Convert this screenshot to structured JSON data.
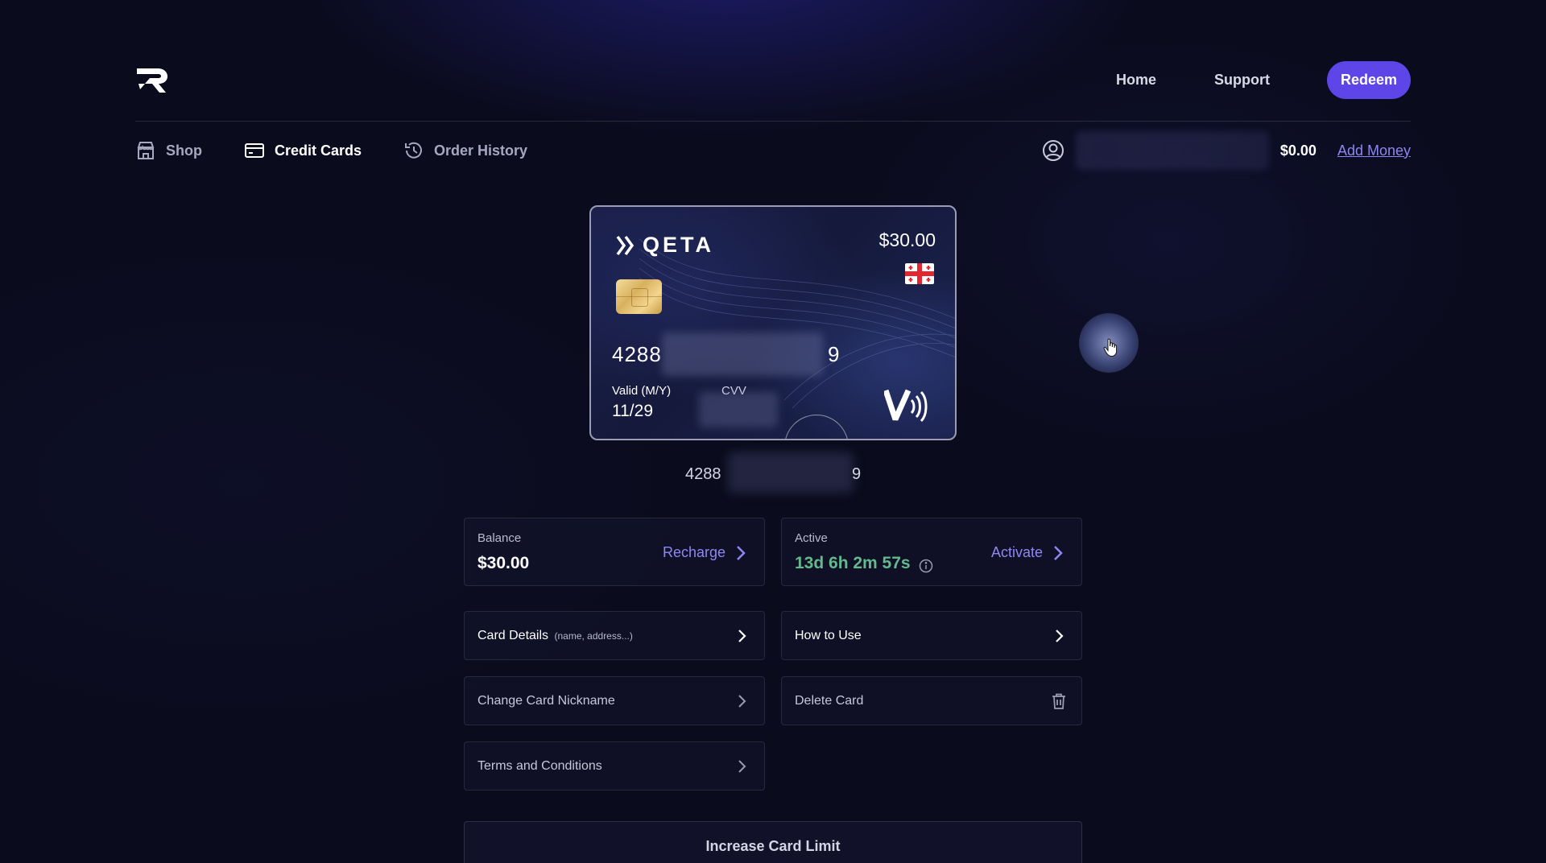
{
  "header": {
    "logo_icon": "r-brand-logo-icon",
    "nav": {
      "home": "Home",
      "support": "Support",
      "redeem": "Redeem"
    },
    "accent_color": "#5d45e8"
  },
  "sub_nav": {
    "items": [
      {
        "label": "Shop",
        "icon": "store-icon"
      },
      {
        "label": "Credit Cards",
        "icon": "credit-card-icon",
        "active": true
      },
      {
        "label": "Order History",
        "icon": "history-icon"
      }
    ]
  },
  "account": {
    "user_icon": "user-circle-icon",
    "balance": "$0.00",
    "add_money": "Add Money"
  },
  "card": {
    "brand": "QETA",
    "amount": "$30.00",
    "number_start": "4288",
    "number_end": "9",
    "valid_label": "Valid (M/Y)",
    "valid_value": "11/29",
    "cvv_label": "CVV",
    "flag_icon": "georgia-flag-icon",
    "network_icon": "visa-contactless-icon"
  },
  "card_number_below": {
    "start": "4288",
    "end": "9"
  },
  "balance_panel": {
    "label": "Balance",
    "value": "$30.00",
    "action": "Recharge"
  },
  "active_panel": {
    "label": "Active",
    "timer": "13d 6h 2m 57s",
    "action": "Activate"
  },
  "rows": {
    "card_details": {
      "label": "Card Details",
      "sub": "(name, address...)"
    },
    "how_to_use": {
      "label": "How to Use"
    },
    "change_nickname": {
      "label": "Change Card Nickname"
    },
    "delete_card": {
      "label": "Delete Card"
    },
    "terms": {
      "label": "Terms and Conditions"
    }
  },
  "increase_limit": "Increase Card Limit",
  "colors": {
    "link": "#8e87f2",
    "timer_green": "#63b98c",
    "background": "#0a0b1c"
  }
}
